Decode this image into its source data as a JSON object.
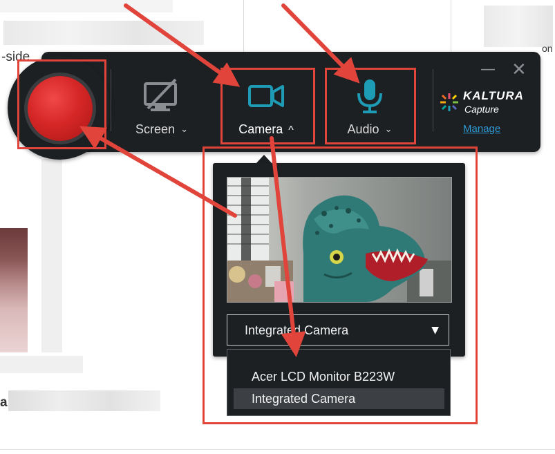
{
  "background": {
    "snippets": [
      "-side",
      "on",
      "a"
    ]
  },
  "toolbar": {
    "screen_label": "Screen",
    "camera_label": "Camera",
    "audio_label": "Audio",
    "screen_chevron": "⌄",
    "camera_chevron": "^",
    "audio_chevron": "⌄",
    "minimize": "—",
    "close": "✕",
    "brand_name": "KALTURA",
    "brand_sub": "Capture",
    "manage_label": "Manage",
    "colors": {
      "record": "#d62727",
      "camera_icon": "#1e9bb5",
      "audio_icon": "#1e9bb5",
      "screen_icon": "#8a8d91"
    }
  },
  "camera_panel": {
    "selected_device": "Integrated Camera",
    "options": [
      "Acer LCD Monitor B223W",
      "Integrated Camera"
    ]
  },
  "annotation_color": "#e0443a"
}
